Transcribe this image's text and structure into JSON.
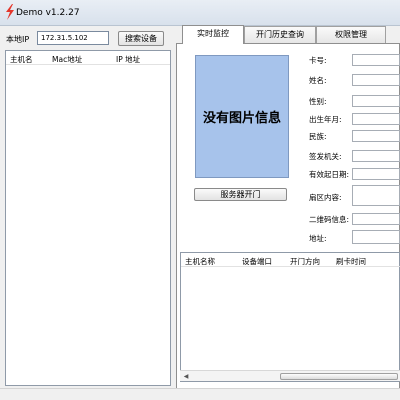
{
  "window": {
    "title": "Demo  v1.2.27"
  },
  "left": {
    "ip_label": "本地IP",
    "ip_value": "172.31.5.102",
    "search_button": "搜索设备",
    "columns": [
      "主机名",
      "Mac地址",
      "IP 地址"
    ]
  },
  "tabs": [
    "实时监控",
    "开门历史查询",
    "权限管理"
  ],
  "monitor": {
    "photo_text": "没有图片信息",
    "open_button": "服务器开门",
    "fields": [
      "卡号:",
      "姓名:",
      "性别:",
      "出生年月:",
      "民族:",
      "签发机关:",
      "有效起日期:",
      "扇区内容:",
      "二维码信息:",
      "地址:"
    ]
  },
  "records": {
    "columns": [
      "主机名称",
      "设备端口",
      "开门方向",
      "刷卡时间"
    ]
  },
  "colors": {
    "photo_bg": "#a7c3eb",
    "accent": "#e4352a"
  }
}
